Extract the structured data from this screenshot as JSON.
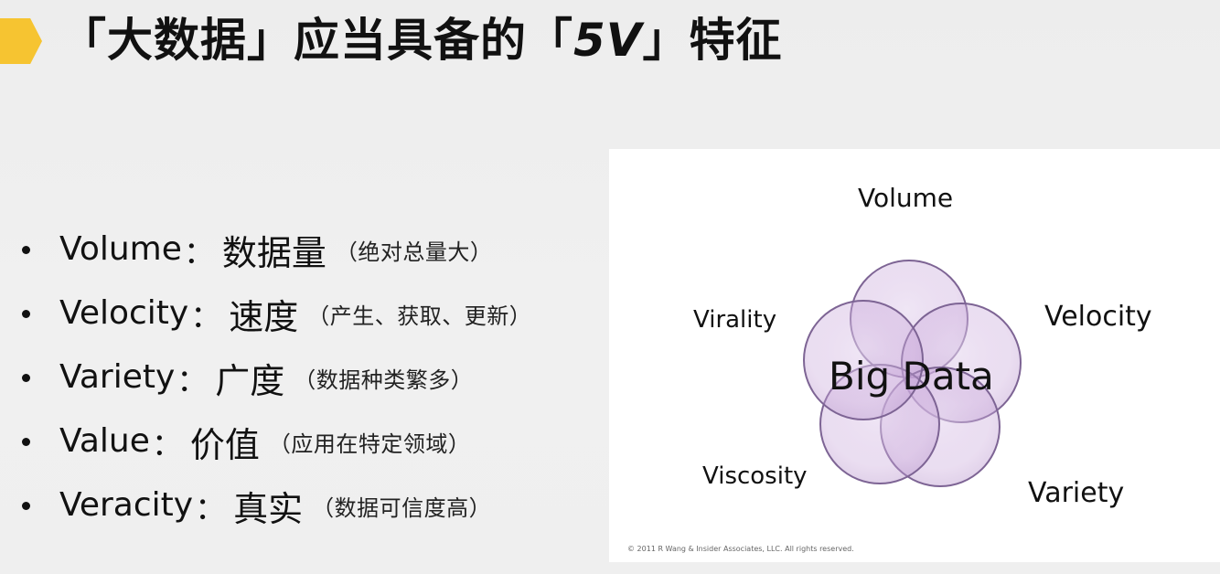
{
  "slide": {
    "title_prefix": "「大数据」应当具备的「",
    "title_bold_v": "5V",
    "title_suffix": "」特征",
    "bullets": [
      {
        "term": "Volume",
        "colon": "：",
        "cn": "数据量",
        "note": "（绝对总量大）"
      },
      {
        "term": "Velocity",
        "colon": "：",
        "cn": "速度",
        "note": "（产生、获取、更新）"
      },
      {
        "term": "Variety",
        "colon": "：",
        "cn": "广度",
        "note": "（数据种类繁多）"
      },
      {
        "term": "Value",
        "colon": "：",
        "cn": "价值",
        "note": "（应用在特定领域）"
      },
      {
        "term": "Veracity",
        "colon": "：",
        "cn": "真实",
        "note": "（数据可信度高）"
      }
    ]
  },
  "diagram": {
    "center_label": "Big Data",
    "labels": {
      "top": "Volume",
      "left": "Virality",
      "right": "Velocity",
      "bottom_left": "Viscosity",
      "bottom_right": "Variety"
    },
    "copyright": "© 2011 R Wang & Insider Associates, LLC.  All rights reserved."
  },
  "colors": {
    "accent": "#f6c431",
    "circle_fill": "#c9a7da",
    "circle_stroke": "#7d6494"
  }
}
